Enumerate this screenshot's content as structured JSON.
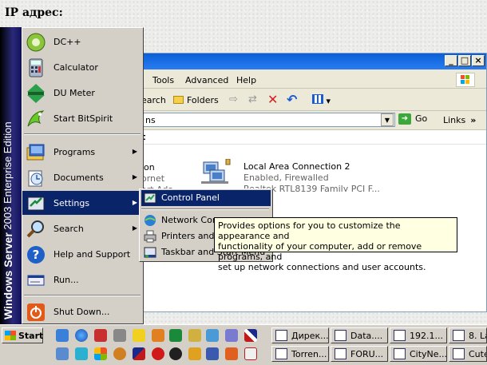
{
  "page": {
    "heading": "IP адрес:"
  },
  "explorer": {
    "menu": [
      "Tools",
      "Advanced",
      "Help"
    ],
    "toolbar": {
      "search_fragment": "earch",
      "folders": "Folders"
    },
    "address": {
      "value_fragment": "ns",
      "go": "Go",
      "links": "Links"
    },
    "content_heading_fragment": "t",
    "left_item_fragments": [
      "ion",
      "ornet",
      "ort Ada"
    ],
    "connection": {
      "name": "Local Area Connection 2",
      "status": "Enabled, Firewalled",
      "device": "Realtek RTL8139 Family PCI F..."
    }
  },
  "start_menu": {
    "sidebar": {
      "bold": "Windows Server",
      "normal": " 2003 Enterprise Edition"
    },
    "pinned": [
      {
        "label": "DC++",
        "icon": "dc-plus-plus-icon"
      },
      {
        "label": "Calculator",
        "icon": "calculator-icon"
      },
      {
        "label": "DU Meter",
        "icon": "du-meter-icon"
      },
      {
        "label": "Start BitSpirit",
        "icon": "bitspirit-icon"
      }
    ],
    "items": [
      {
        "label": "Programs",
        "icon": "programs-icon"
      },
      {
        "label": "Documents",
        "icon": "documents-icon"
      },
      {
        "label": "Settings",
        "icon": "settings-icon"
      },
      {
        "label": "Search",
        "icon": "search-icon"
      },
      {
        "label": "Help and Support",
        "icon": "help-icon"
      },
      {
        "label": "Run...",
        "icon": "run-icon"
      },
      {
        "label": "Shut Down...",
        "icon": "shutdown-icon"
      }
    ],
    "settings_submenu": [
      {
        "label": "Control Panel",
        "icon": "control-panel-icon"
      },
      {
        "label": "Network Conn",
        "icon": "network-connections-icon"
      },
      {
        "label": "Printers and F",
        "icon": "printers-icon"
      },
      {
        "label": "Taskbar and Start Menu",
        "icon": "taskbar-icon"
      }
    ]
  },
  "tooltip": {
    "line1": "Provides options for you to customize the appearance and",
    "line2": "functionality of your computer, add or remove programs, and",
    "line3": "set up network connections and user accounts."
  },
  "taskbar": {
    "start_label": "Start",
    "tasks_row1": [
      "Дирек...",
      "Data....",
      "192.1...",
      "8. La"
    ],
    "tasks_row2": [
      "Torren...",
      "FORU...",
      "CityNe...",
      "Cute"
    ]
  },
  "colors": {
    "highlight": "#0a246a",
    "titlebar": "#0a5fd8",
    "tooltip_bg": "#ffffe1"
  }
}
